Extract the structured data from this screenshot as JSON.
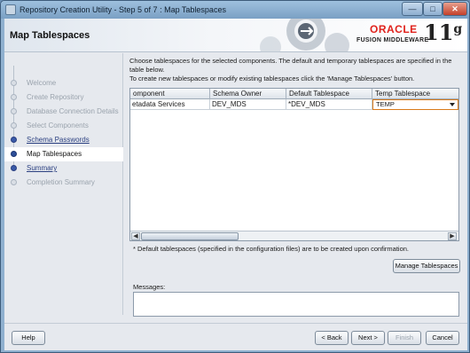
{
  "window": {
    "title": "Repository Creation Utility - Step 5 of 7 : Map Tablespaces",
    "min_glyph": "—",
    "max_glyph": "□",
    "close_glyph": "✕"
  },
  "header": {
    "page_title": "Map Tablespaces",
    "logo_oracle": "ORACLE",
    "logo_fmw": "FUSION MIDDLEWARE",
    "logo_version": "11",
    "logo_version_suffix": "g"
  },
  "nav": {
    "items": [
      {
        "label": "Welcome",
        "state": "disabled"
      },
      {
        "label": "Create Repository",
        "state": "disabled"
      },
      {
        "label": "Database Connection Details",
        "state": "disabled"
      },
      {
        "label": "Select Components",
        "state": "disabled"
      },
      {
        "label": "Schema Passwords",
        "state": "link"
      },
      {
        "label": "Map Tablespaces",
        "state": "active"
      },
      {
        "label": "Summary",
        "state": "link"
      },
      {
        "label": "Completion Summary",
        "state": "disabled"
      }
    ]
  },
  "main": {
    "instruction_1": "Choose tablespaces for the selected components. The default and temporary tablespaces are specified in the table below.",
    "instruction_2": "To create new tablespaces or modify existing tablespaces click the 'Manage Tablespaces' button.",
    "table": {
      "columns": [
        "omponent",
        "Schema Owner",
        "Default Tablespace",
        "Temp Tablespace"
      ],
      "rows": [
        {
          "component": "etadata Services",
          "schema_owner": "DEV_MDS",
          "default_tablespace": "*DEV_MDS",
          "temp_tablespace": "TEMP"
        }
      ]
    },
    "footnote": "* Default tablespaces (specified in the configuration files) are to be created upon confirmation.",
    "manage_button": "Manage Tablespaces",
    "messages_label": "Messages:",
    "messages_text": ""
  },
  "footer": {
    "help": "Help",
    "back": "< Back",
    "next": "Next >",
    "finish": "Finish",
    "cancel": "Cancel"
  },
  "colors": {
    "accent": "#2d4e98",
    "oracle_red": "#e0221c",
    "selection_border": "#d97a1a"
  },
  "icons": {
    "scroll_left": "◀",
    "scroll_right": "▶"
  }
}
